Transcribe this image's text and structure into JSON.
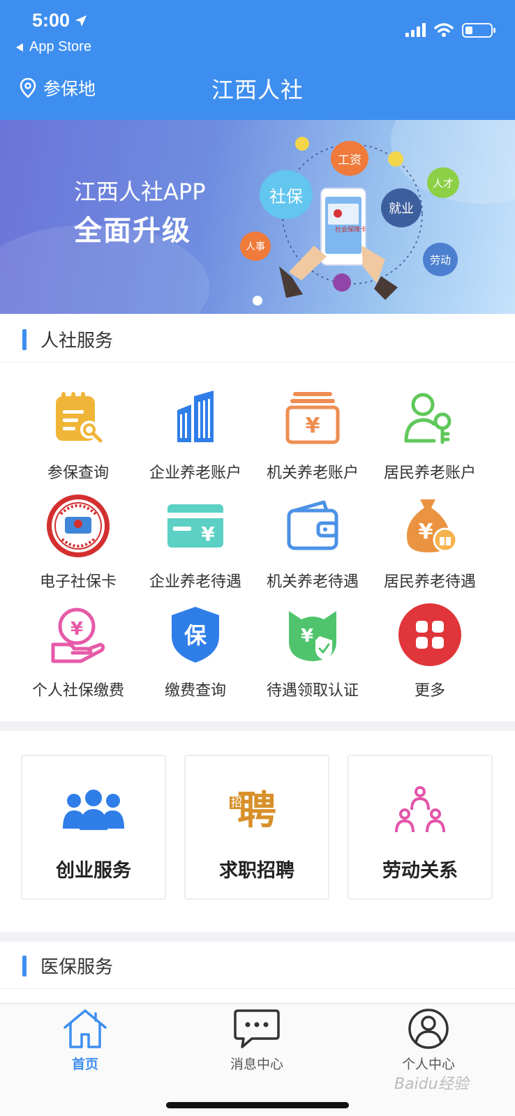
{
  "status_bar": {
    "time": "5:00",
    "back_label": "App Store"
  },
  "header": {
    "location_label": "参保地",
    "title": "江西人社"
  },
  "banner": {
    "line1": "江西人社APP",
    "line2": "全面升级",
    "bubbles": [
      "社保",
      "工资",
      "就业",
      "人才",
      "人事",
      "劳动"
    ],
    "card_text": "社会保障卡"
  },
  "section_renshe": {
    "title": "人社服务"
  },
  "services": [
    {
      "label": "参保查询",
      "icon": "document-search-icon"
    },
    {
      "label": "企业养老账户",
      "icon": "building-icon"
    },
    {
      "label": "机关养老账户",
      "icon": "yuan-box-icon"
    },
    {
      "label": "居民养老账户",
      "icon": "person-key-icon"
    },
    {
      "label": "电子社保卡",
      "icon": "social-security-card-seal-icon"
    },
    {
      "label": "企业养老待遇",
      "icon": "yuan-card-icon"
    },
    {
      "label": "机关养老待遇",
      "icon": "wallet-icon"
    },
    {
      "label": "居民养老待遇",
      "icon": "money-bag-icon"
    },
    {
      "label": "个人社保缴费",
      "icon": "hand-yuan-icon"
    },
    {
      "label": "缴费查询",
      "icon": "shield-bao-icon"
    },
    {
      "label": "待遇领取认证",
      "icon": "yuan-shield-check-icon"
    },
    {
      "label": "更多",
      "icon": "more-grid-icon"
    }
  ],
  "cards": [
    {
      "label": "创业服务",
      "icon": "group-people-icon"
    },
    {
      "label": "求职招聘",
      "icon": "pin-char-icon",
      "glyph_small": "招",
      "glyph_big": "聘"
    },
    {
      "label": "劳动关系",
      "icon": "relation-people-icon"
    }
  ],
  "section_yibao": {
    "title": "医保服务"
  },
  "tabs": [
    {
      "label": "首页",
      "icon": "home-icon",
      "active": true
    },
    {
      "label": "消息中心",
      "icon": "message-icon",
      "active": false
    },
    {
      "label": "个人中心",
      "icon": "user-icon",
      "active": false
    }
  ],
  "watermark": "Baidu经验",
  "colors": {
    "primary": "#3e8ef0",
    "gold": "#e8b546",
    "orange": "#e9914a",
    "green": "#5ec85e",
    "red": "#e0353b",
    "teal": "#5fd0c7",
    "pink": "#e052a8"
  }
}
